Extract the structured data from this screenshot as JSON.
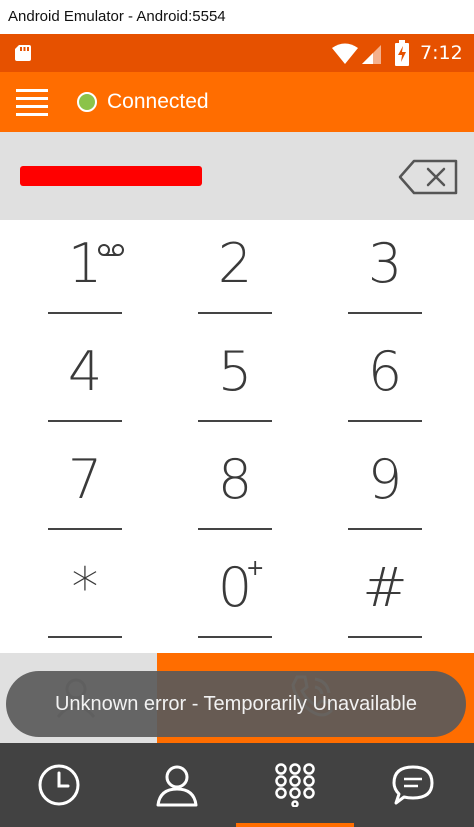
{
  "window": {
    "title": "Android Emulator - Android:5554"
  },
  "status_bar": {
    "time": "7:12",
    "icons": [
      "sd-card-icon",
      "wifi-icon",
      "signal-icon",
      "battery-charging-icon"
    ],
    "background": "#e65100"
  },
  "app_bar": {
    "menu_icon": "hamburger-menu-icon",
    "status_text": "Connected",
    "status_color": "#8bc34a",
    "background": "#ff6d00"
  },
  "dialer": {
    "number": "redacted",
    "backspace_icon": "backspace-icon",
    "keys": [
      {
        "digit": "1",
        "sub": "voicemail"
      },
      {
        "digit": "2",
        "sub": ""
      },
      {
        "digit": "3",
        "sub": ""
      },
      {
        "digit": "4",
        "sub": ""
      },
      {
        "digit": "5",
        "sub": ""
      },
      {
        "digit": "6",
        "sub": ""
      },
      {
        "digit": "7",
        "sub": ""
      },
      {
        "digit": "8",
        "sub": ""
      },
      {
        "digit": "9",
        "sub": ""
      },
      {
        "digit": "*",
        "sub": ""
      },
      {
        "digit": "0",
        "sub": "+"
      },
      {
        "digit": "#",
        "sub": ""
      }
    ]
  },
  "actions": {
    "contact_icon": "add-contact-icon",
    "call_icon": "call-icon",
    "accent": "#ff6d00"
  },
  "toast": {
    "message": "Unknown error - Temporarily Unavailable"
  },
  "bottom_nav": {
    "items": [
      {
        "icon": "history-clock-icon",
        "active": false
      },
      {
        "icon": "contacts-person-icon",
        "active": false
      },
      {
        "icon": "dialpad-icon",
        "active": true
      },
      {
        "icon": "chat-bubble-icon",
        "active": false
      }
    ],
    "background": "#424242"
  }
}
